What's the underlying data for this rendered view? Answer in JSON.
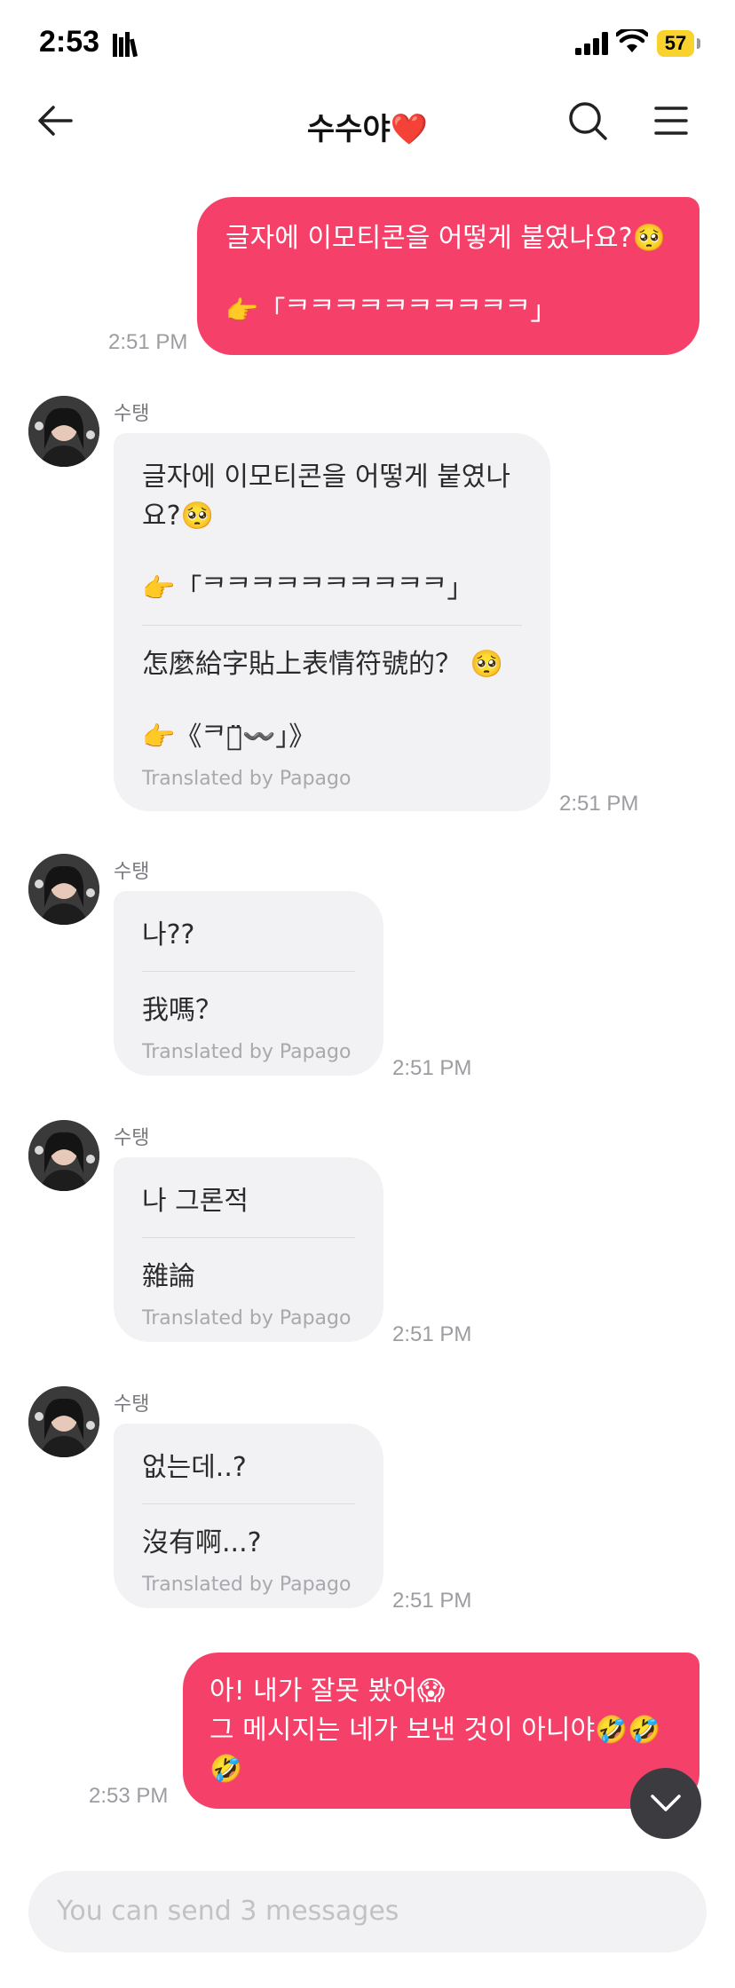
{
  "status_bar": {
    "time": "2:53",
    "battery": "57"
  },
  "header": {
    "title": "수수야❤️"
  },
  "messages": [
    {
      "type": "outgoing",
      "lines": [
        "글자에 이모티콘을 어떻게 붙였나요?🥺",
        "",
        "👉「ᄏᄏᄏᄏᄏᄏᄏᄏᄏᄏ」"
      ],
      "time": "2:51 PM"
    },
    {
      "type": "incoming",
      "sender": "수탱",
      "original": [
        "글자에 이모티콘을 어떻게 붙였나",
        "요?🥺",
        "",
        "👉「ᄏᄏᄏᄏᄏᄏᄏᄏᄏᄏ」"
      ],
      "translation": [
        "怎麼給字貼上表情符號的？ 🥺",
        "",
        "👉《ᄏᄏ̈̈̈〰️」》"
      ],
      "translated_by": "Translated by Papago",
      "time": "2:51 PM"
    },
    {
      "type": "incoming",
      "sender": "수탱",
      "original": [
        "나??"
      ],
      "translation": [
        "我嗎？"
      ],
      "translated_by": "Translated by Papago",
      "time": "2:51 PM"
    },
    {
      "type": "incoming",
      "sender": "수탱",
      "original": [
        "나 그론적"
      ],
      "translation": [
        "雜論"
      ],
      "translated_by": "Translated by Papago",
      "time": "2:51 PM"
    },
    {
      "type": "incoming",
      "sender": "수탱",
      "original": [
        "없는데..?"
      ],
      "translation": [
        "沒有啊...?"
      ],
      "translated_by": "Translated by Papago",
      "time": "2:51 PM"
    },
    {
      "type": "outgoing",
      "lines": [
        "아! 내가 잘못 봤어😱",
        "그 메시지는 네가 보낸 것이 아니야🤣🤣",
        "🤣"
      ],
      "time": "2:53 PM"
    }
  ],
  "composer": {
    "placeholder": "You can send 3 messages"
  },
  "colors": {
    "outgoing_bubble": "#f5416a",
    "incoming_bubble": "#f2f2f4",
    "battery": "#f9d22e"
  },
  "icons": [
    "back-arrow-icon",
    "search-icon",
    "menu-icon",
    "chevron-down-icon",
    "signal-icon",
    "wifi-icon"
  ]
}
